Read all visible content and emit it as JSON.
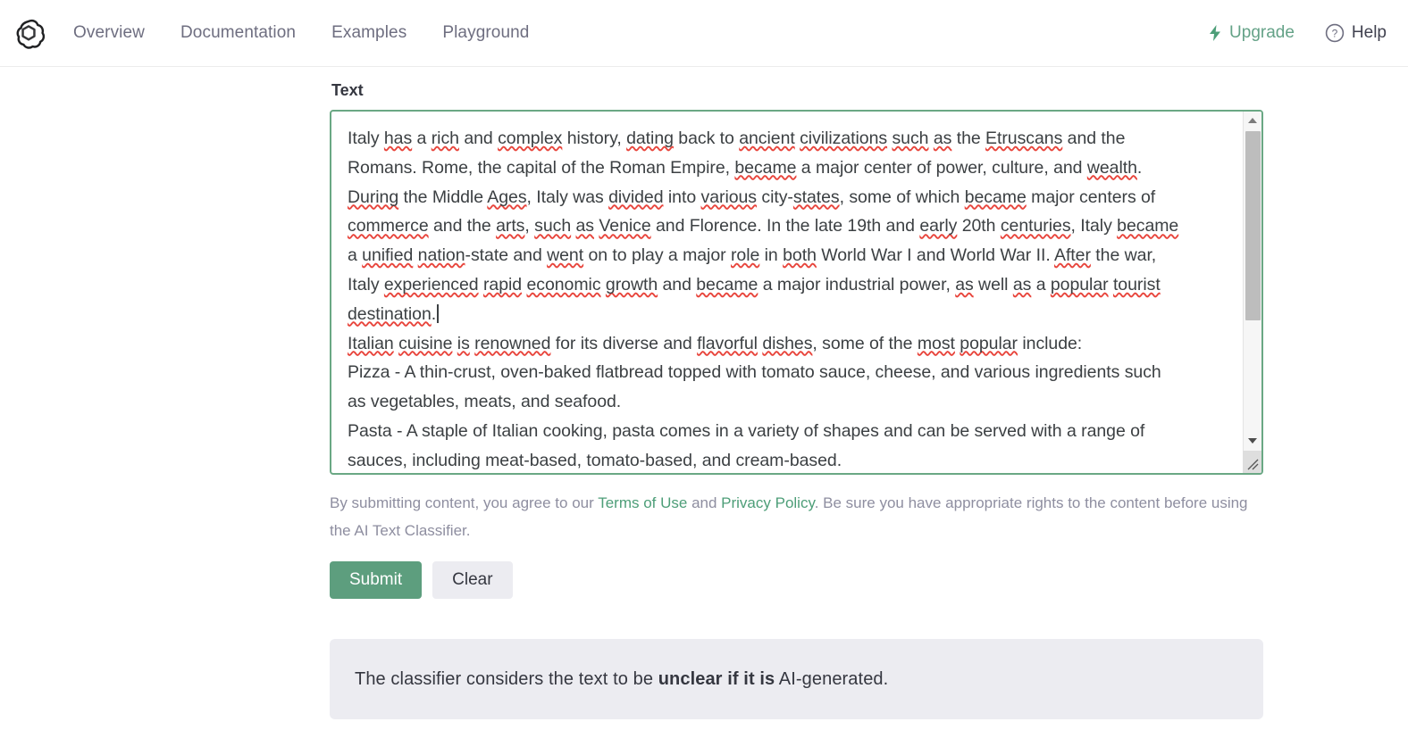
{
  "header": {
    "logo_name": "openai-logo",
    "nav": [
      {
        "label": "Overview"
      },
      {
        "label": "Documentation"
      },
      {
        "label": "Examples"
      },
      {
        "label": "Playground"
      }
    ],
    "upgrade": {
      "label": "Upgrade",
      "icon": "bolt-icon",
      "color": "#64a287"
    },
    "help": {
      "label": "Help",
      "icon": "question-circle-icon",
      "color": "#40414f"
    }
  },
  "main": {
    "field_label": "Text",
    "textarea": {
      "lines": [
        "Italy has a rich and complex history, dating back to ancient civilizations such as the Etruscans and the",
        "Romans. Rome, the capital of the Roman Empire, became a major center of power, culture, and wealth.",
        "During the Middle Ages, Italy was divided into various city-states, some of which became major centers of",
        "commerce and the arts, such as Venice and Florence. In the late 19th and early 20th centuries, Italy became",
        "a unified nation-state and went on to play a major role in both World War I and World War II. After the war,",
        "Italy experienced rapid economic growth and became a major industrial power, as well as a popular tourist",
        "destination.",
        "Italian cuisine is renowned for its diverse and flavorful dishes, some of the most popular include:",
        "Pizza - A thin-crust, oven-baked flatbread topped with tomato sauce, cheese, and various ingredients such",
        "as vegetables, meats, and seafood.",
        "Pasta - A staple of Italian cooking, pasta comes in a variety of shapes and can be served with a range of",
        "sauces, including meat-based, tomato-based, and cream-based."
      ],
      "border_color": "#6aa884",
      "caret_after": "destination."
    },
    "disclaimer": {
      "part1": "By submitting content, you agree to our ",
      "link1": "Terms of Use",
      "part2": " and ",
      "link2": "Privacy Policy",
      "part3": ". Be sure you have appropriate rights to the content before using the AI Text Classifier.",
      "link_color": "#4d9e78"
    },
    "submit_label": "Submit",
    "clear_label": "Clear",
    "submit_color": "#5d9e7e",
    "result": {
      "prefix": "The classifier considers the text to be ",
      "emphasis": "unclear if it is",
      "suffix": " AI-generated.",
      "background": "#ececf1"
    }
  }
}
